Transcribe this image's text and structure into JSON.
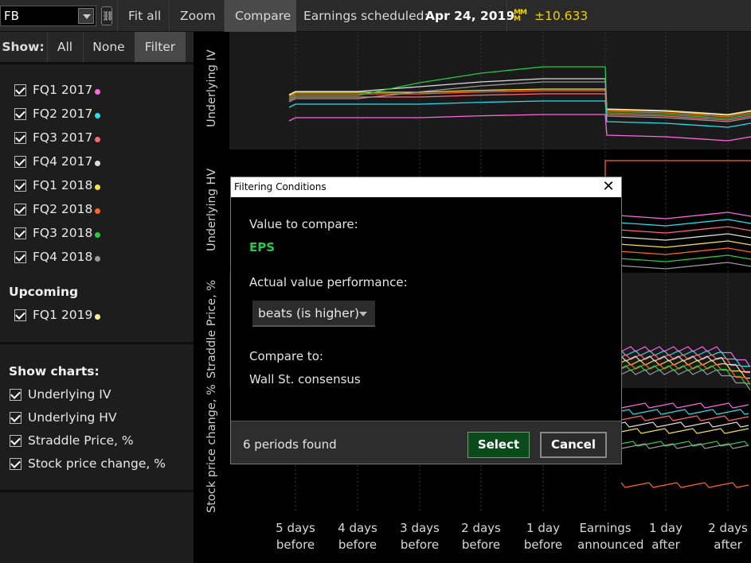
{
  "toolbar": {
    "symbol": "FB",
    "link_icon": "link-icon",
    "fit_all": "Fit all",
    "zoom": "Zoom",
    "compare": "Compare",
    "earnings_label": "Earnings scheduled:",
    "earnings_date": "Apr 24, 2019",
    "mm_icon": "market-maker-move-icon",
    "mm_value": "±10.633",
    "accent_color": "#f0d000"
  },
  "show": {
    "label": "Show:",
    "all": "All",
    "none": "None",
    "filter": "Filter"
  },
  "periods": [
    {
      "label": "FQ1 2017",
      "color": "#ff66e0"
    },
    {
      "label": "FQ2 2017",
      "color": "#22e0f0"
    },
    {
      "label": "FQ3 2017",
      "color": "#ff6677"
    },
    {
      "label": "FQ4 2017",
      "color": "#dddddd"
    },
    {
      "label": "FQ1 2018",
      "color": "#f5e04a"
    },
    {
      "label": "FQ2 2018",
      "color": "#ff6622"
    },
    {
      "label": "FQ3 2018",
      "color": "#22cc44"
    },
    {
      "label": "FQ4 2018",
      "color": "#999999"
    }
  ],
  "upcoming": {
    "heading": "Upcoming",
    "items": [
      {
        "label": "FQ1 2019",
        "color": "#ffee99"
      }
    ]
  },
  "show_charts": {
    "heading": "Show charts:",
    "items": [
      "Underlying IV",
      "Underlying HV",
      "Straddle Price, %",
      "Stock price change, %"
    ]
  },
  "charts": {
    "y_labels": [
      "Underlying IV",
      "Underlying HV",
      "Straddle Price, %",
      "Stock price change, %"
    ],
    "x_labels": [
      [
        "5 days",
        "before"
      ],
      [
        "4 days",
        "before"
      ],
      [
        "3 days",
        "before"
      ],
      [
        "2 days",
        "before"
      ],
      [
        "1 day",
        "before"
      ],
      [
        "Earnings",
        "announced"
      ],
      [
        "1 day",
        "after"
      ],
      [
        "2 days",
        "after"
      ]
    ]
  },
  "dialog": {
    "title": "Filtering Conditions",
    "value_to_compare_label": "Value to compare:",
    "value_to_compare": "EPS",
    "value_color": "#22cc44",
    "performance_label": "Actual value performance:",
    "performance_value": "beats (is higher)",
    "compare_to_label": "Compare to:",
    "compare_to_value": "Wall St. consensus",
    "found_text": "6 periods found",
    "select": "Select",
    "cancel": "Cancel"
  }
}
